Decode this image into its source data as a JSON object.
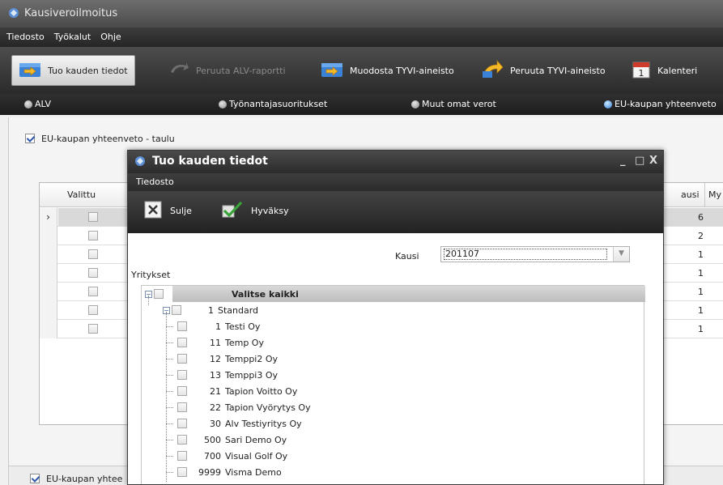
{
  "window": {
    "title": "Kausiveroilmoitus"
  },
  "menu": [
    "Tiedosto",
    "Työkalut",
    "Ohje"
  ],
  "toolbar": {
    "tuo": "Tuo kauden tiedot",
    "peruuta_alv": "Peruuta ALV-raportti",
    "muodosta": "Muodosta TYVI-aineisto",
    "peruuta_tyvi": "Peruuta TYVI-aineisto",
    "kalenteri": "Kalenteri",
    "calendar_number": "1"
  },
  "radios": {
    "alv": "ALV",
    "tyonantaja": "Työnantajasuoritukset",
    "muut": "Muut omat verot",
    "eu": "EU-kaupan yhteenveto"
  },
  "content": {
    "group_title": "EU-kaupan yhteenveto - taulu",
    "bottom_group_title": "EU-kaupan yhtee",
    "grid": {
      "col_valittu": "Valittu",
      "col_kausi": "ausi",
      "col_my": "My",
      "rows": [
        6,
        2,
        1,
        1,
        1,
        1,
        1
      ],
      "current_marker": "›"
    }
  },
  "dialog": {
    "title": "Tuo kauden tiedot",
    "menu_tiedosto": "Tiedosto",
    "sulje": "Sulje",
    "hyvaksy": "Hyväksy",
    "kausi_label": "Kausi",
    "kausi_value": "201107",
    "yritykset_label": "Yritykset",
    "tree": {
      "root": "Valitse kaikki",
      "group": {
        "code": "1",
        "name": "Standard"
      },
      "companies": [
        {
          "code": "1",
          "name": "Testi Oy"
        },
        {
          "code": "11",
          "name": "Temp Oy"
        },
        {
          "code": "12",
          "name": "Temppi2 Oy"
        },
        {
          "code": "13",
          "name": "Temppi3 Oy"
        },
        {
          "code": "21",
          "name": "Tapion Voitto Oy"
        },
        {
          "code": "22",
          "name": "Tapion Vyörytys Oy"
        },
        {
          "code": "30",
          "name": "Alv Testiyritys Oy"
        },
        {
          "code": "500",
          "name": "Sari Demo Oy"
        },
        {
          "code": "700",
          "name": "Visual Golf Oy"
        },
        {
          "code": "9999",
          "name": "Visma Demo"
        }
      ]
    }
  },
  "colors": {
    "accent": "#2f7ed6",
    "dark_bar": "#2a2a2a"
  }
}
